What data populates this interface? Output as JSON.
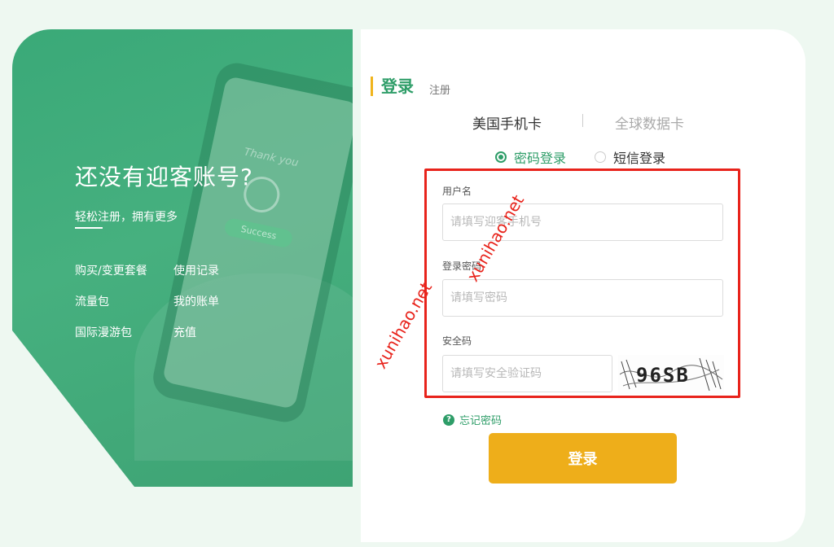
{
  "promo": {
    "title": "还没有迎客账号?",
    "subtitle": "轻松注册，拥有更多",
    "phone_text": "Thank you",
    "phone_button": "Success",
    "links": [
      "购买/变更套餐",
      "使用记录",
      "流量包",
      "我的账单",
      "国际漫游包",
      "充值"
    ]
  },
  "auth_tabs": {
    "login": "登录",
    "register": "注册"
  },
  "card_types": {
    "us": "美国手机卡",
    "global": "全球数据卡"
  },
  "login_modes": {
    "password": "密码登录",
    "sms": "短信登录",
    "selected": "password"
  },
  "form": {
    "username_label": "用户名",
    "username_placeholder": "请填写迎客手机号",
    "password_label": "登录密码",
    "password_placeholder": "请填写密码",
    "captcha_label": "安全码",
    "captcha_placeholder": "请填写安全验证码",
    "captcha_text": "96SB"
  },
  "forgot": {
    "icon": "?",
    "label": "忘记密码"
  },
  "submit_label": "登录",
  "watermarks": [
    "xunihao.net",
    "xunihao.net"
  ],
  "colors": {
    "brand_green": "#2e9d68",
    "accent_gold": "#eeae1a",
    "highlight_red": "#e8231b"
  }
}
